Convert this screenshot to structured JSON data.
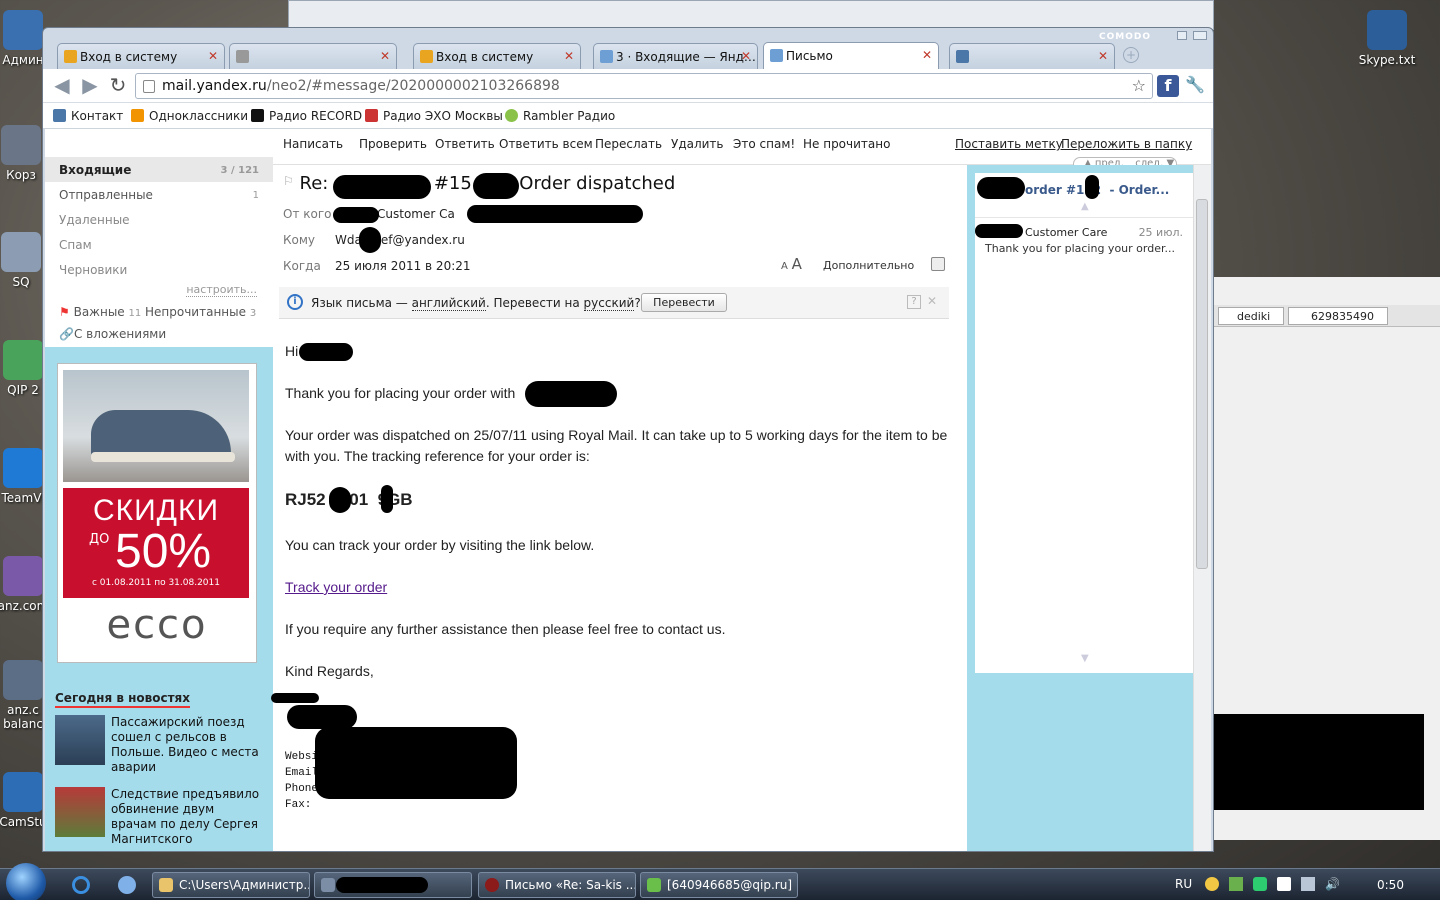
{
  "desktop": {
    "icons_left": [
      {
        "label": "Админ"
      },
      {
        "label": "Корз"
      },
      {
        "label": "SQ"
      },
      {
        "label": "QIP 2"
      },
      {
        "label": "TeamVi"
      },
      {
        "label": "anz.com"
      },
      {
        "label": "anz.c balanc"
      },
      {
        "label": "CamStu"
      }
    ],
    "icon_right": {
      "label": "Skype.txt"
    }
  },
  "browser": {
    "brand": "COMODO",
    "tabs": [
      {
        "label": "Вход в систему",
        "active": false
      },
      {
        "label": "",
        "active": false
      },
      {
        "label": "Вход в систему",
        "active": false
      },
      {
        "label": "3 · Входящие — Янд…",
        "active": false
      },
      {
        "label": "Письмо",
        "active": true
      },
      {
        "label": "",
        "active": false
      }
    ],
    "url": {
      "host": "mail.yandex.ru",
      "path": "/neo2/#message/2020000002103266898"
    },
    "bookmarks": [
      {
        "label": "Контакт"
      },
      {
        "label": "Одноклассники"
      },
      {
        "label": "Радио RECORD"
      },
      {
        "label": "Радио ЭХО Москвы"
      },
      {
        "label": "Rambler Радио"
      }
    ]
  },
  "mail": {
    "actions": [
      "Написать",
      "Проверить",
      "Ответить",
      "Ответить всем",
      "Переслать",
      "Удалить",
      "Это спам!",
      "Не прочитано"
    ],
    "actions_right": [
      "Поставить метку",
      "Переложить в папку"
    ],
    "nav_prev": "пред.",
    "nav_next": "след.",
    "folders": [
      {
        "label": "Входящие",
        "count": "3 / 121"
      },
      {
        "label": "Отправленные",
        "count": "1"
      },
      {
        "label": "Удаленные",
        "count": ""
      },
      {
        "label": "Спам",
        "count": ""
      },
      {
        "label": "Черновики",
        "count": ""
      }
    ],
    "settings_link": "настроить...",
    "important": {
      "label": "Важные",
      "count": "11"
    },
    "unread": {
      "label": "Непрочитанные",
      "count": "3"
    },
    "attachments": "С вложениями",
    "ad": {
      "discount_line1": "СКИДКИ",
      "discount_prefix": "ДО",
      "discount_value": "50%",
      "dates": "с 01.08.2011 по 31.08.2011",
      "brand": "ecco"
    },
    "news_title": "Сегодня в новостях",
    "news": [
      {
        "text": "Пассажирский поезд сошел с рельсов в Польше. Видео с места аварии"
      },
      {
        "text": "Следствие предъявило обвинение двум врачам по делу Сергея Магнитского"
      }
    ],
    "message": {
      "subject_prefix": "Re:",
      "subject_mid": "#15",
      "subject_end": "Order dispatched",
      "from_label": "От кого",
      "from_value": "Customer Ca",
      "to_label": "Кому",
      "to_value": "Wda     ef@yandex.ru",
      "date_label": "Когда",
      "date_value": "25 июля 2011 в 20:21",
      "font_small": "A",
      "font_big": "A",
      "more": "Дополнительно",
      "translate_text": "Язык письма — ",
      "translate_lang": "английский",
      "translate_mid": ". Перевести на ",
      "translate_target": "русский",
      "translate_q": "?",
      "translate_button": "Перевести",
      "body": {
        "greeting": "Hi",
        "thanks": "Thank you for placing your order with",
        "dispatched": "Your order was dispatched on 25/07/11 using Royal Mail. It can take up to 5 working days for the item to be with you. The tracking reference for your order is:",
        "tracking": "RJ52   101  9GB",
        "track_info": "You can track your order by visiting the link below.",
        "track_link": "Track your order",
        "assist": "If you require any further assistance then please feel free to contact us.",
        "regards": "Kind Regards,",
        "sig": [
          "Websi",
          "Email:",
          "Phone:",
          "Fax:"
        ]
      }
    },
    "thread": {
      "title": "order #152  - Order...",
      "sender": "Customer Care",
      "date": "25 июл.",
      "snippet": "Thank you for placing your order..."
    }
  },
  "bgapp": {
    "tab1": "dediki",
    "tab2": "629835490"
  },
  "taskbar": {
    "items": [
      {
        "label": "C:\\Users\\Администр..."
      },
      {
        "label": ""
      },
      {
        "label": "Письмо «Re: Sa-kis ..."
      },
      {
        "label": "[640946685@qip.ru] ..."
      }
    ],
    "lang": "RU",
    "clock": "0:50"
  }
}
